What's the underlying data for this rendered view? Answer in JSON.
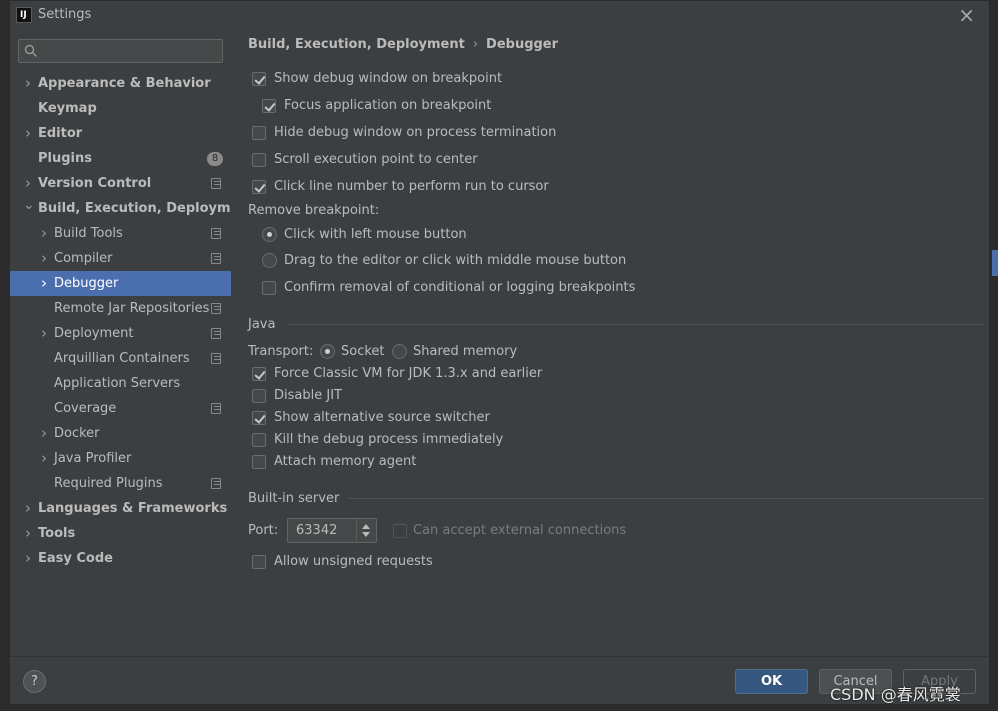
{
  "window": {
    "title": "Settings",
    "app_icon": "intellij-icon"
  },
  "search": {
    "placeholder": ""
  },
  "sidebar": {
    "items": [
      {
        "label": "Appearance & Behavior",
        "bold": true,
        "chevron": "right",
        "level": 0
      },
      {
        "label": "Keymap",
        "bold": true,
        "chevron": "",
        "level": 0
      },
      {
        "label": "Editor",
        "bold": true,
        "chevron": "right",
        "level": 0
      },
      {
        "label": "Plugins",
        "bold": true,
        "chevron": "",
        "level": 0,
        "badge": "8"
      },
      {
        "label": "Version Control",
        "bold": true,
        "chevron": "right",
        "level": 0,
        "project_icon": true
      },
      {
        "label": "Build, Execution, Deployment",
        "bold": true,
        "chevron": "down",
        "level": 0
      },
      {
        "label": "Build Tools",
        "chevron": "right",
        "level": 1,
        "project_icon": true
      },
      {
        "label": "Compiler",
        "chevron": "right",
        "level": 1,
        "project_icon": true
      },
      {
        "label": "Debugger",
        "chevron": "right",
        "level": 1,
        "selected": true
      },
      {
        "label": "Remote Jar Repositories",
        "chevron": "",
        "level": 1,
        "project_icon": true
      },
      {
        "label": "Deployment",
        "chevron": "right",
        "level": 1,
        "project_icon": true
      },
      {
        "label": "Arquillian Containers",
        "chevron": "",
        "level": 1,
        "project_icon": true
      },
      {
        "label": "Application Servers",
        "chevron": "",
        "level": 1
      },
      {
        "label": "Coverage",
        "chevron": "",
        "level": 1,
        "project_icon": true
      },
      {
        "label": "Docker",
        "chevron": "right",
        "level": 1
      },
      {
        "label": "Java Profiler",
        "chevron": "right",
        "level": 1
      },
      {
        "label": "Required Plugins",
        "chevron": "",
        "level": 1,
        "project_icon": true
      },
      {
        "label": "Languages & Frameworks",
        "bold": true,
        "chevron": "right",
        "level": 0
      },
      {
        "label": "Tools",
        "bold": true,
        "chevron": "right",
        "level": 0
      },
      {
        "label": "Easy Code",
        "bold": true,
        "chevron": "right",
        "level": 0
      }
    ]
  },
  "breadcrumb": {
    "parent": "Build, Execution, Deployment",
    "separator": "›",
    "current": "Debugger"
  },
  "general": {
    "show_debug_window": {
      "label": "Show debug window on breakpoint",
      "checked": true
    },
    "focus_application": {
      "label": "Focus application on breakpoint",
      "checked": true
    },
    "hide_debug_window": {
      "label": "Hide debug window on process termination",
      "checked": false
    },
    "scroll_execution": {
      "label": "Scroll execution point to center",
      "checked": false
    },
    "click_line_number": {
      "label": "Click line number to perform run to cursor",
      "checked": true
    }
  },
  "remove_breakpoint": {
    "title": "Remove breakpoint:",
    "option_click": {
      "label": "Click with left mouse button",
      "selected": true
    },
    "option_drag": {
      "label": "Drag to the editor or click with middle mouse button",
      "selected": false
    },
    "confirm_removal": {
      "label": "Confirm removal of conditional or logging breakpoints",
      "checked": false
    }
  },
  "java": {
    "title": "Java",
    "transport_label": "Transport:",
    "socket": {
      "label": "Socket",
      "selected": true
    },
    "shared_memory": {
      "label": "Shared memory",
      "selected": false
    },
    "force_classic_vm": {
      "label": "Force Classic VM for JDK 1.3.x and earlier",
      "checked": true
    },
    "disable_jit": {
      "label": "Disable JIT",
      "checked": false
    },
    "alt_source_switcher": {
      "label": "Show alternative source switcher",
      "checked": true
    },
    "kill_process": {
      "label": "Kill the debug process immediately",
      "checked": false
    },
    "attach_memory_agent": {
      "label": "Attach memory agent",
      "checked": false
    }
  },
  "server": {
    "title": "Built-in server",
    "port_label": "Port:",
    "port_value": "63342",
    "external_connections": {
      "label": "Can accept external connections",
      "checked": false,
      "enabled": false
    },
    "unsigned_requests": {
      "label": "Allow unsigned requests",
      "checked": false
    }
  },
  "footer": {
    "help": "?",
    "ok": "OK",
    "cancel": "Cancel",
    "apply": "Apply"
  },
  "watermark": "CSDN @春风霓裳",
  "colors": {
    "selection": "#4b6eaf",
    "ok_button": "#365880",
    "background": "#3c3f41"
  }
}
